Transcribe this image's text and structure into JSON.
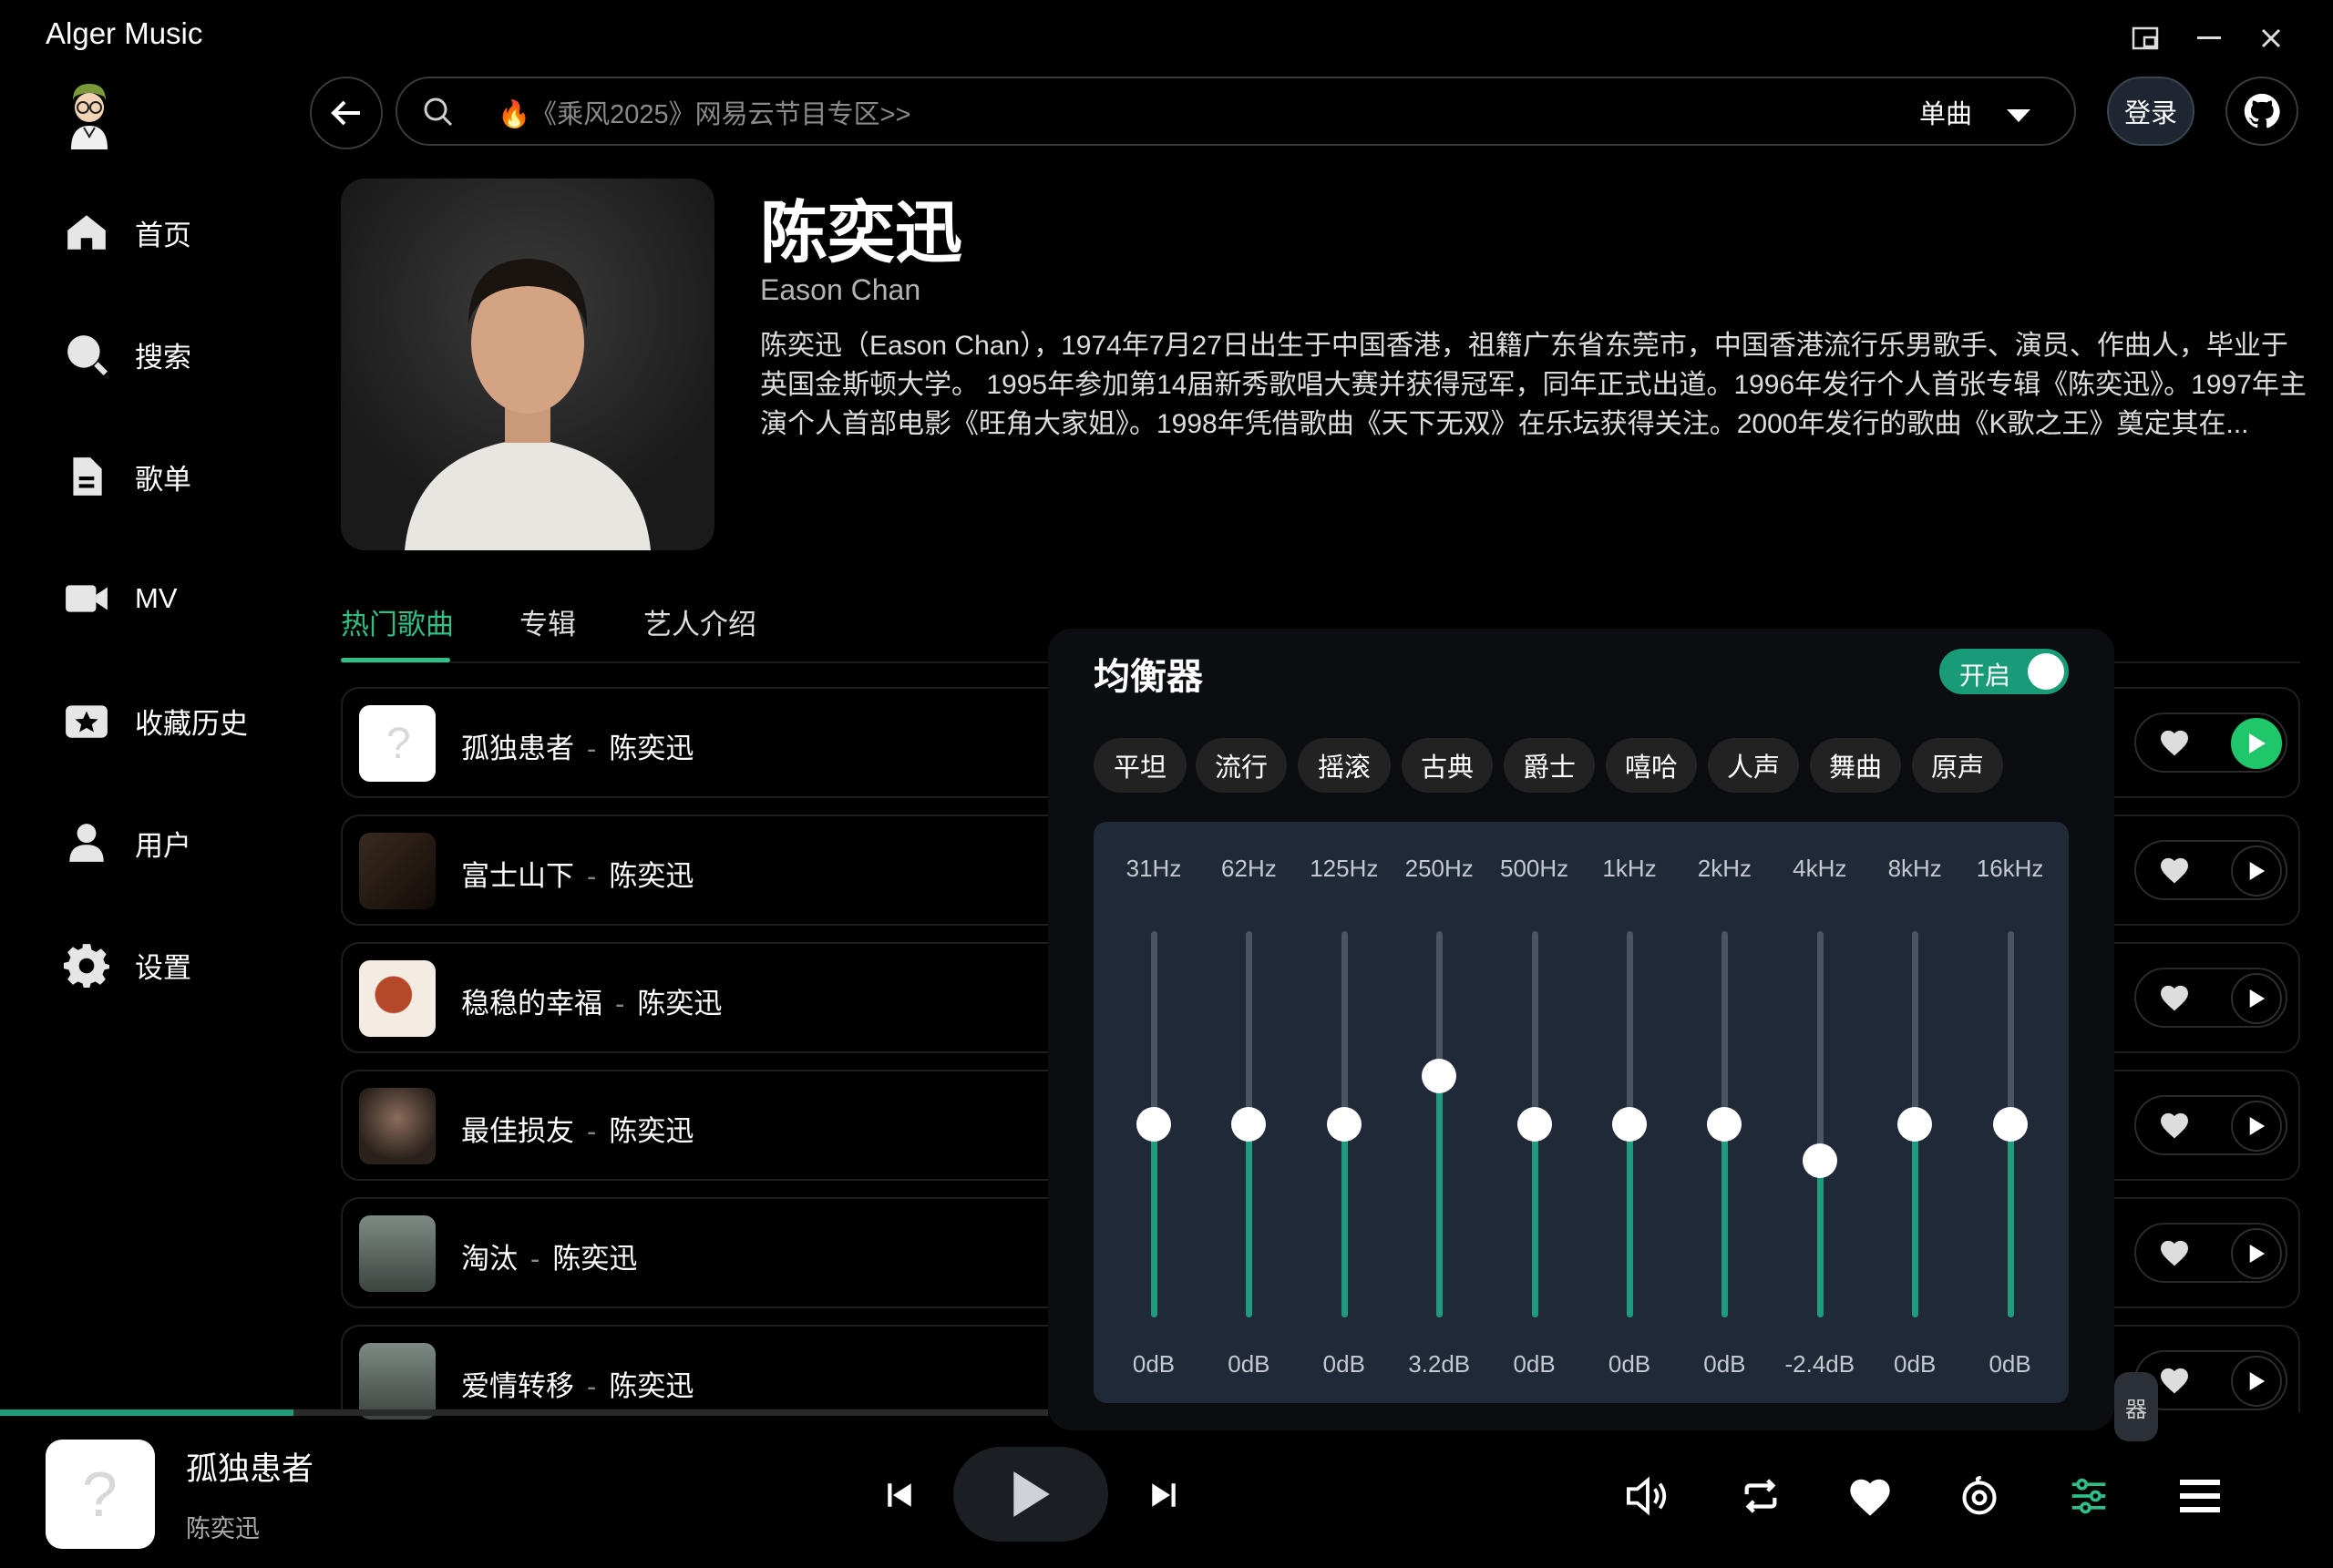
{
  "app": {
    "title": "Alger Music"
  },
  "sidebar": {
    "items": [
      {
        "label": "首页",
        "icon": "home-icon"
      },
      {
        "label": "搜索",
        "icon": "search-icon"
      },
      {
        "label": "歌单",
        "icon": "playlist-icon"
      },
      {
        "label": "MV",
        "icon": "video-icon"
      },
      {
        "label": "收藏历史",
        "icon": "favorites-icon"
      },
      {
        "label": "用户",
        "icon": "user-icon"
      },
      {
        "label": "设置",
        "icon": "gear-icon"
      }
    ]
  },
  "header": {
    "search_placeholder": "🔥《乘风2025》网易云节目专区>>",
    "search_type": "单曲",
    "login_label": "登录"
  },
  "artist": {
    "name": "陈奕迅",
    "english_name": "Eason Chan",
    "bio": "陈奕迅（Eason Chan），1974年7月27日出生于中国香港，祖籍广东省东莞市，中国香港流行乐男歌手、演员、作曲人，毕业于英国金斯顿大学。 1995年参加第14届新秀歌唱大赛并获得冠军，同年正式出道。1996年发行个人首张专辑《陈奕迅》。1997年主演个人首部电影《旺角大家姐》。1998年凭借歌曲《天下无双》在乐坛获得关注。2000年发行的歌曲《K歌之王》奠定其在..."
  },
  "tabs": [
    {
      "label": "热门歌曲",
      "active": true
    },
    {
      "label": "专辑",
      "active": false
    },
    {
      "label": "艺人介绍",
      "active": false
    }
  ],
  "songs": [
    {
      "title": "孤独患者",
      "artist": "陈奕迅",
      "separator": "-",
      "playing": true
    },
    {
      "title": "富士山下",
      "artist": "陈奕迅",
      "separator": "-",
      "playing": false
    },
    {
      "title": "稳稳的幸福",
      "artist": "陈奕迅",
      "separator": "-",
      "playing": false
    },
    {
      "title": "最佳损友",
      "artist": "陈奕迅",
      "separator": "-",
      "playing": false
    },
    {
      "title": "淘汰",
      "artist": "陈奕迅",
      "separator": "-",
      "playing": false
    },
    {
      "title": "爱情转移",
      "artist": "陈奕迅",
      "separator": "-",
      "playing": false
    }
  ],
  "equalizer": {
    "title": "均衡器",
    "toggle_label": "开启",
    "enabled": true,
    "presets": [
      "平坦",
      "流行",
      "摇滚",
      "古典",
      "爵士",
      "嘻哈",
      "人声",
      "舞曲",
      "原声"
    ],
    "bands": [
      {
        "freq": "31Hz",
        "gain_label": "0dB",
        "gain": 0
      },
      {
        "freq": "62Hz",
        "gain_label": "0dB",
        "gain": 0
      },
      {
        "freq": "125Hz",
        "gain_label": "0dB",
        "gain": 0
      },
      {
        "freq": "250Hz",
        "gain_label": "3.2dB",
        "gain": 3.2
      },
      {
        "freq": "500Hz",
        "gain_label": "0dB",
        "gain": 0
      },
      {
        "freq": "1kHz",
        "gain_label": "0dB",
        "gain": 0
      },
      {
        "freq": "2kHz",
        "gain_label": "0dB",
        "gain": 0
      },
      {
        "freq": "4kHz",
        "gain_label": "-2.4dB",
        "gain": -2.4
      },
      {
        "freq": "8kHz",
        "gain_label": "0dB",
        "gain": 0
      },
      {
        "freq": "16kHz",
        "gain_label": "0dB",
        "gain": 0
      }
    ],
    "side_tag": "器"
  },
  "player": {
    "title": "孤独患者",
    "artist": "陈奕迅",
    "progress": 0.17
  },
  "colors": {
    "accent": "#2fbf87",
    "eq_fill": "#1f9c7e",
    "play_active": "#1fc76a",
    "eq_panel": "#202937"
  }
}
